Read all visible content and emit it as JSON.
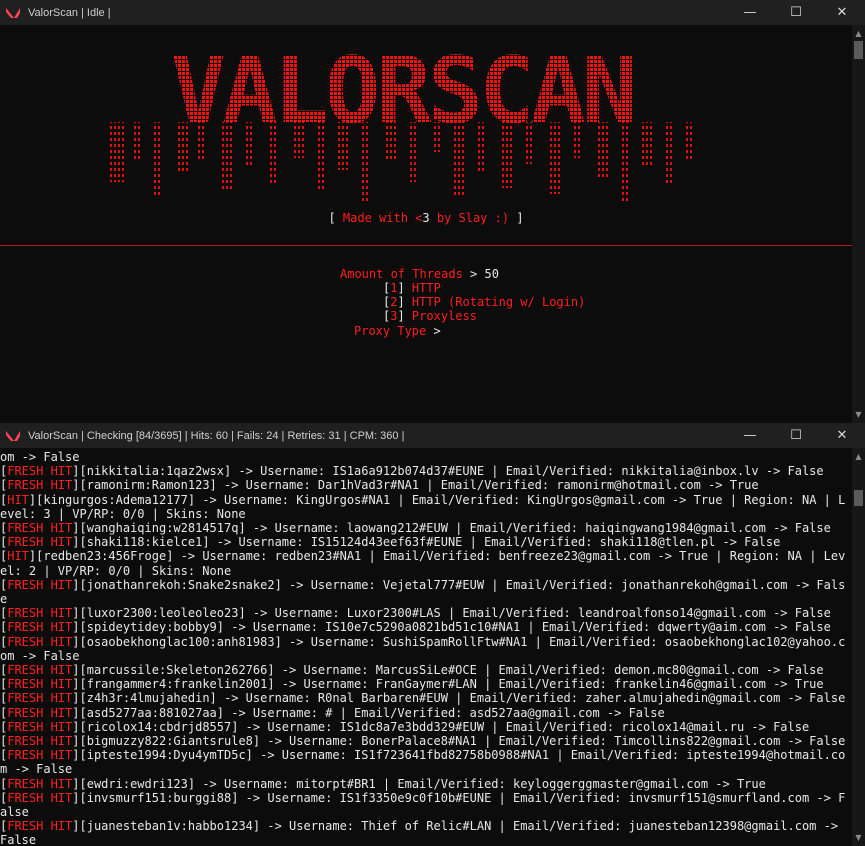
{
  "window_top": {
    "title": "ValorScan | Idle |",
    "banner_text": "VALORSCAN",
    "credit_open": "[ ",
    "credit_made": "Made with <",
    "credit_three": "3",
    "credit_by": " by Slay :)",
    "credit_close": " ]",
    "threads_label": "Amount of Threads",
    "threads_arrow": " > ",
    "threads_value": "50",
    "options": [
      {
        "num": "1",
        "label": "HTTP"
      },
      {
        "num": "2",
        "label": "HTTP (Rotating w/ Login)"
      },
      {
        "num": "3",
        "label": "Proxyless"
      }
    ],
    "proxy_label": "Proxy Type",
    "proxy_arrow": " >"
  },
  "window_bottom": {
    "title": "ValorScan | Checking [84/3695] | Hits: 60 | Fails: 24 | Retries: 31 | CPM: 360 |",
    "lines": [
      {
        "tag": "",
        "text": "om -> False"
      },
      {
        "tag": "FRESH HIT",
        "text": "[nikkitalia:1qaz2wsx] -> Username: IS1a6a912b074d37#EUNE | Email/Verified: nikkitalia@inbox.lv -> False"
      },
      {
        "tag": "FRESH HIT",
        "text": "[ramonirm:Ramon123] -> Username: Dar1hVad3r#NA1 | Email/Verified: ramonirm@hotmail.com -> True"
      },
      {
        "tag": "HIT",
        "text": "[kingurgos:Adema12177] -> Username: KingUrgos#NA1 | Email/Verified: KingUrgos@gmail.com -> True | Region: NA | Level: 3 | VP/RP: 0/0 | Skins: None"
      },
      {
        "tag": "FRESH HIT",
        "text": "[wanghaiqing:w2814517q] -> Username: laowang212#EUW | Email/Verified: haiqingwang1984@gmail.com -> False"
      },
      {
        "tag": "FRESH HIT",
        "text": "[shaki118:kielce1] -> Username: IS15124d43eef63f#EUNE | Email/Verified: shaki118@tlen.pl -> False"
      },
      {
        "tag": "HIT",
        "text": "[redben23:456Froge] -> Username: redben23#NA1 | Email/Verified: benfreeze23@gmail.com -> True | Region: NA | Level: 2 | VP/RP: 0/0 | Skins: None"
      },
      {
        "tag": "FRESH HIT",
        "text": "[jonathanrekoh:Snake2snake2] -> Username: Vejetal777#EUW | Email/Verified: jonathanrekoh@gmail.com -> False"
      },
      {
        "tag": "FRESH HIT",
        "text": "[luxor2300:leoleoleo23] -> Username: Luxor2300#LAS | Email/Verified: leandroalfonso14@gmail.com -> False"
      },
      {
        "tag": "FRESH HIT",
        "text": "[spideytidey:bobby9] -> Username: IS10e7c5290a0821bd51c10#NA1 | Email/Verified: dqwerty@aim.com -> False"
      },
      {
        "tag": "FRESH HIT",
        "text": "[osaobekhonglac100:anh81983] -> Username: SushiSpamRollFtw#NA1 | Email/Verified: osaobekhonglac102@yahoo.com -> False"
      },
      {
        "tag": "FRESH HIT",
        "text": "[marcussile:Skeleton262766] -> Username: MarcusSiLe#OCE | Email/Verified: demon.mc80@gmail.com -> False"
      },
      {
        "tag": "FRESH HIT",
        "text": "[frangammer4:frankelin2001] -> Username: FranGaymer#LAN | Email/Verified: frankelin46@gmail.com -> True"
      },
      {
        "tag": "FRESH HIT",
        "text": "[z4h3r:4lmujahedin] -> Username: R0nal Barbaren#EUW | Email/Verified: zaher.almujahedin@gmail.com -> False"
      },
      {
        "tag": "FRESH HIT",
        "text": "[asd5277aa:881027aa] -> Username: # | Email/Verified: asd527aa@gmail.com -> False"
      },
      {
        "tag": "FRESH HIT",
        "text": "[ricolox14:cbdrjd8557] -> Username: IS1dc8a7e3bdd329#EUW | Email/Verified: ricolox14@mail.ru -> False"
      },
      {
        "tag": "FRESH HIT",
        "text": "[bigmuzzy822:Giantsrule8] -> Username: BonerPalace8#NA1 | Email/Verified: Timcollins822@gmail.com -> False"
      },
      {
        "tag": "FRESH HIT",
        "text": "[ipteste1994:Dyu4ymTD5c] -> Username: IS1f723641fbd82758b0988#NA1 | Email/Verified: ipteste1994@hotmail.com -> False"
      },
      {
        "tag": "FRESH HIT",
        "text": "[ewdri:ewdri123] -> Username: mitorpt#BR1 | Email/Verified: keyloggerggmaster@gmail.com -> True"
      },
      {
        "tag": "FRESH HIT",
        "text": "[invsmurf151:burggi88] -> Username: IS1f3350e9c0f10b#EUNE | Email/Verified: invsmurf151@smurfland.com -> False"
      },
      {
        "tag": "FRESH HIT",
        "text": "[juanesteban1v:habbo1234] -> Username: Thief of Relic#LAN | Email/Verified: juanesteban12398@gmail.com -> False"
      }
    ]
  },
  "colors": {
    "accent_red": "#ff1f1f",
    "text": "#e8e8e8",
    "background": "#0c0c0c",
    "titlebar": "#202020"
  },
  "icons": {
    "app": "valorant-logo-icon",
    "minimize": "minimize-icon",
    "maximize": "maximize-icon",
    "close": "close-icon"
  }
}
